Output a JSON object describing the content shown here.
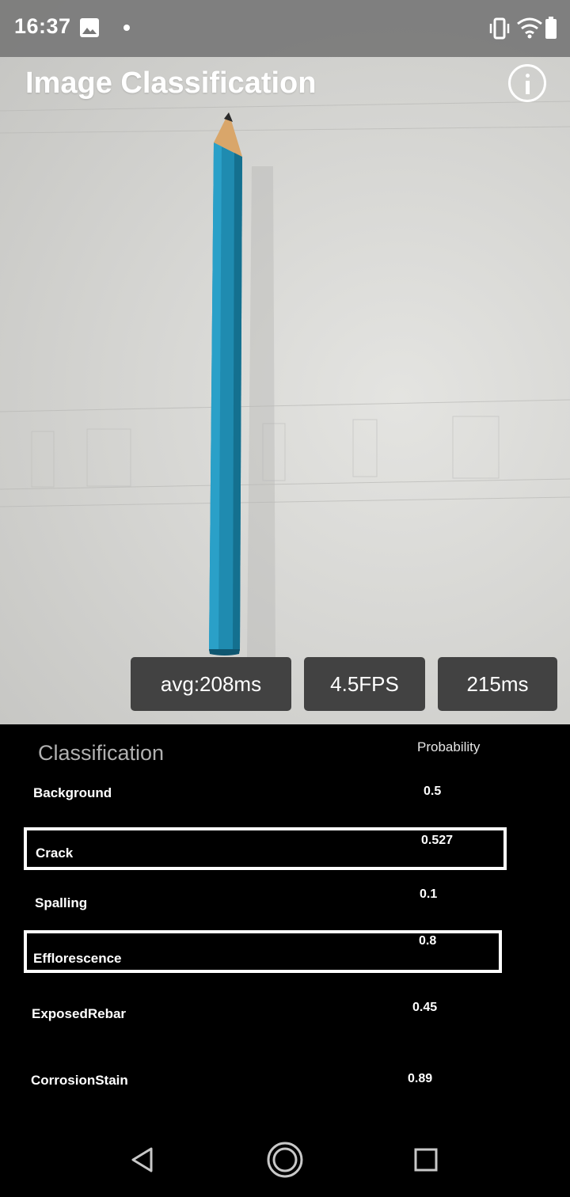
{
  "status": {
    "time": "16:37"
  },
  "app": {
    "title": "Image Classification"
  },
  "stats": {
    "avg": "avg:208ms",
    "fps": "4.5FPS",
    "latency": "215ms"
  },
  "results": {
    "header_class": "Classification",
    "header_prob": "Probability",
    "rows": [
      {
        "label": "Background",
        "value": "0.5",
        "highlighted": false
      },
      {
        "label": "Crack",
        "value": "0.527",
        "highlighted": true
      },
      {
        "label": "Spalling",
        "value": "0.1",
        "highlighted": false
      },
      {
        "label": "Efflorescence",
        "value": "0.8",
        "highlighted": true
      },
      {
        "label": "ExposedRebar",
        "value": "0.45",
        "highlighted": false
      },
      {
        "label": "CorrosionStain",
        "value": "0.89",
        "highlighted": false
      }
    ]
  },
  "colors": {
    "pencil": "#1f8bb0",
    "panel": "#000000",
    "pill": "#373737"
  },
  "icons": [
    "image-icon",
    "vibrate-icon",
    "wifi-icon",
    "battery-icon",
    "info-icon",
    "back-icon",
    "home-icon",
    "recents-icon"
  ]
}
